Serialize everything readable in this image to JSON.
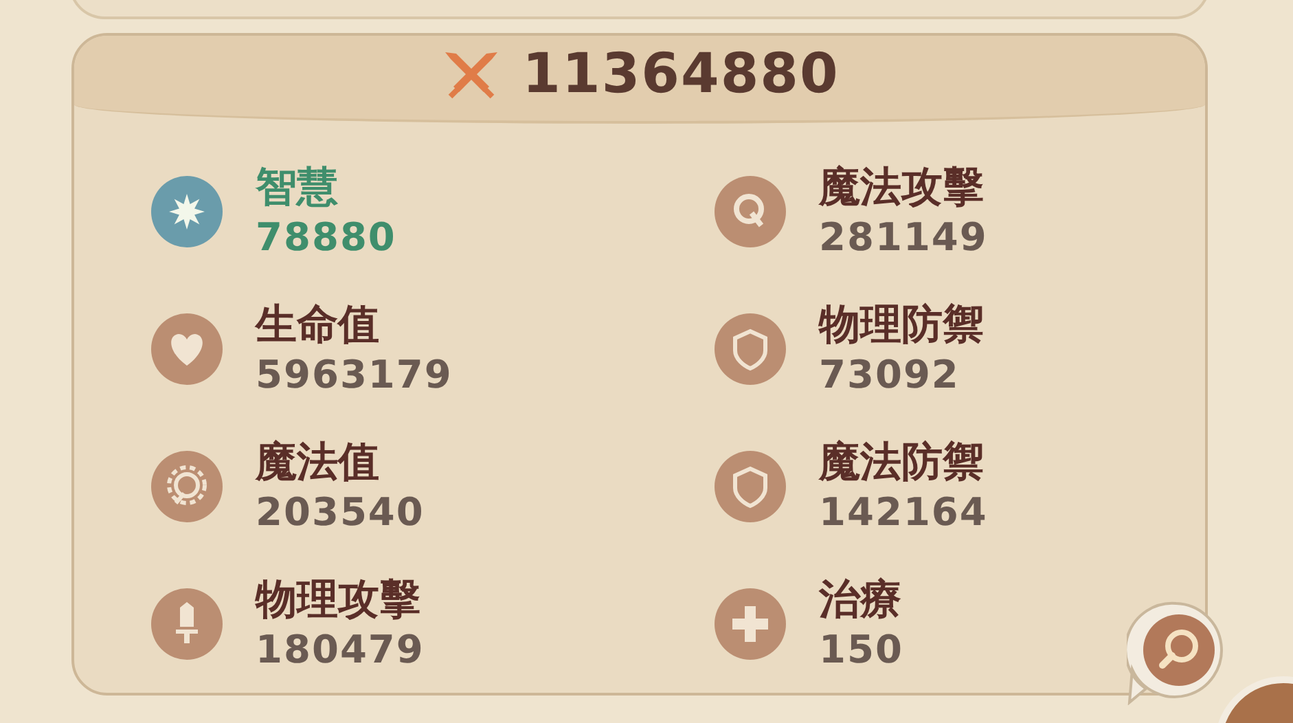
{
  "power": {
    "value": "11364880"
  },
  "stats": [
    {
      "kind": "star",
      "label": "智慧",
      "value": "78880",
      "highlighted": true
    },
    {
      "kind": "magic",
      "label": "魔法攻擊",
      "value": "281149",
      "highlighted": false
    },
    {
      "kind": "heart",
      "label": "生命值",
      "value": "5963179",
      "highlighted": false
    },
    {
      "kind": "shield",
      "label": "物理防禦",
      "value": "73092",
      "highlighted": false
    },
    {
      "kind": "sun",
      "label": "魔法值",
      "value": "203540",
      "highlighted": false
    },
    {
      "kind": "shield",
      "label": "魔法防禦",
      "value": "142164",
      "highlighted": false
    },
    {
      "kind": "sword",
      "label": "物理攻擊",
      "value": "180479",
      "highlighted": false
    },
    {
      "kind": "plus",
      "label": "治療",
      "value": "150",
      "highlighted": false
    }
  ]
}
